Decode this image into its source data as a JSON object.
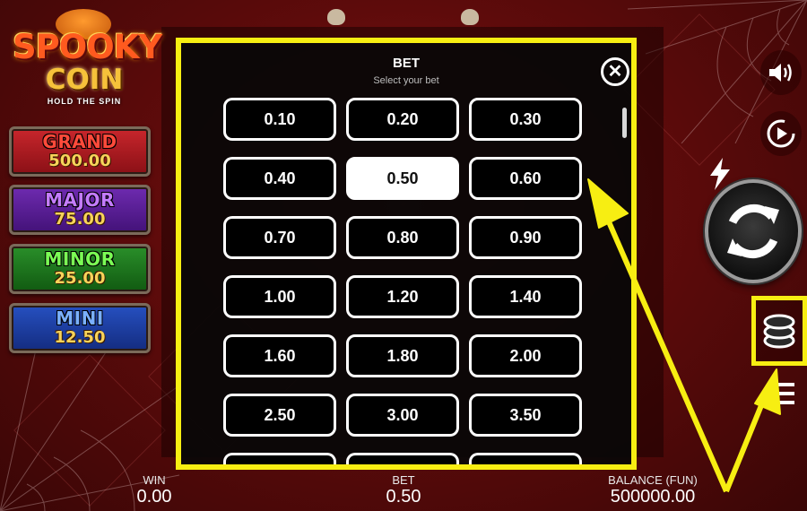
{
  "logo": {
    "title": "SPOOKY",
    "coin": "COIN",
    "subtitle": "HOLD THE SPIN"
  },
  "jackpots": [
    {
      "name": "GRAND",
      "value": "500.00",
      "color": "#b81b22",
      "name_color": "#ff4a3a"
    },
    {
      "name": "MAJOR",
      "value": "75.00",
      "color": "#5e1f9e",
      "name_color": "#c47cff"
    },
    {
      "name": "MINOR",
      "value": "25.00",
      "color": "#1d7a1d",
      "name_color": "#7bff55"
    },
    {
      "name": "MINI",
      "value": "12.50",
      "color": "#1c3fa8",
      "name_color": "#7ab0ff"
    }
  ],
  "bet_modal": {
    "title": "BET",
    "subtitle": "Select your bet",
    "selected": "0.50",
    "options": [
      "0.10",
      "0.20",
      "0.30",
      "0.40",
      "0.50",
      "0.60",
      "0.70",
      "0.80",
      "0.90",
      "1.00",
      "1.20",
      "1.40",
      "1.60",
      "1.80",
      "2.00",
      "2.50",
      "3.00",
      "3.50"
    ],
    "close_icon": "close-icon"
  },
  "controls": {
    "sound_icon": "speaker-icon",
    "autoplay_icon": "autoplay-icon",
    "turbo_icon": "lightning-icon",
    "spin_icon": "spin-arrows-icon",
    "bet_icon": "coin-stack-icon",
    "menu_icon": "menu-icon"
  },
  "info": {
    "win_label": "WIN",
    "win_value": "0.00",
    "bet_label": "BET",
    "bet_value": "0.50",
    "balance_label": "BALANCE (FUN)",
    "balance_value": "500000.00"
  },
  "colors": {
    "highlight": "#f7ee12",
    "background": "#6b0d0d",
    "jackpot_value": "#f8d35a"
  }
}
